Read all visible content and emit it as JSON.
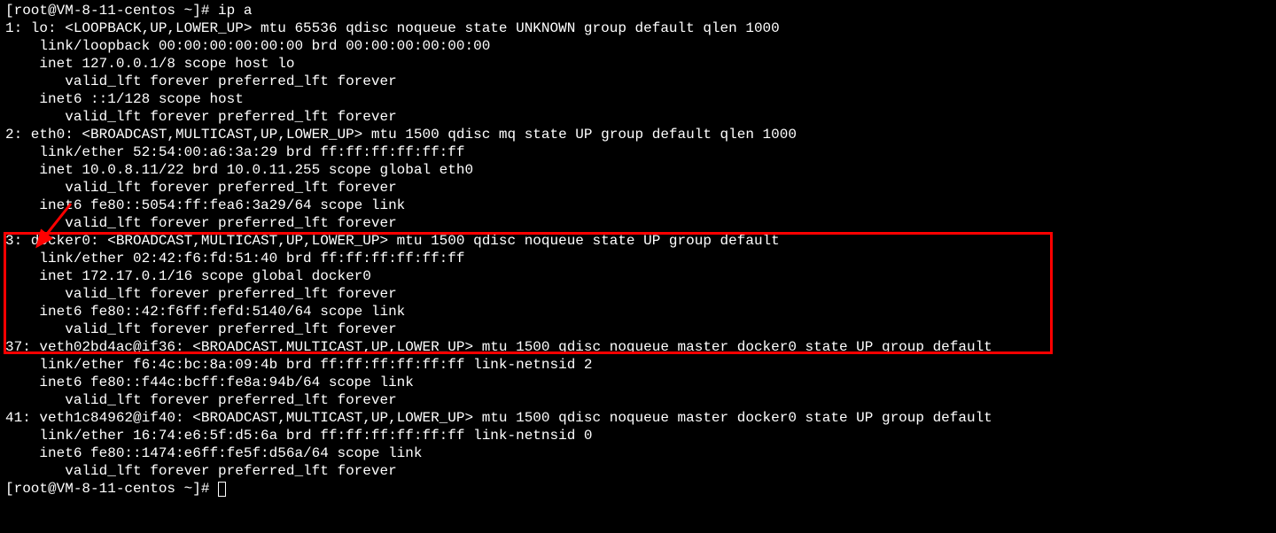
{
  "terminal": {
    "prompt1": "[root@VM-8-11-centos ~]# ip a",
    "l01": "1: lo: <LOOPBACK,UP,LOWER_UP> mtu 65536 qdisc noqueue state UNKNOWN group default qlen 1000",
    "l02": "    link/loopback 00:00:00:00:00:00 brd 00:00:00:00:00:00",
    "l03": "    inet 127.0.0.1/8 scope host lo",
    "l04": "       valid_lft forever preferred_lft forever",
    "l05": "    inet6 ::1/128 scope host ",
    "l06": "       valid_lft forever preferred_lft forever",
    "l07": "2: eth0: <BROADCAST,MULTICAST,UP,LOWER_UP> mtu 1500 qdisc mq state UP group default qlen 1000",
    "l08": "    link/ether 52:54:00:a6:3a:29 brd ff:ff:ff:ff:ff:ff",
    "l09": "    inet 10.0.8.11/22 brd 10.0.11.255 scope global eth0",
    "l10": "       valid_lft forever preferred_lft forever",
    "l11": "    inet6 fe80::5054:ff:fea6:3a29/64 scope link ",
    "l12": "       valid_lft forever preferred_lft forever",
    "l13": "3: docker0: <BROADCAST,MULTICAST,UP,LOWER_UP> mtu 1500 qdisc noqueue state UP group default ",
    "l14": "    link/ether 02:42:f6:fd:51:40 brd ff:ff:ff:ff:ff:ff",
    "l15": "    inet 172.17.0.1/16 scope global docker0",
    "l16": "       valid_lft forever preferred_lft forever",
    "l17": "    inet6 fe80::42:f6ff:fefd:5140/64 scope link ",
    "l18": "       valid_lft forever preferred_lft forever",
    "l19": "37: veth02bd4ac@if36: <BROADCAST,MULTICAST,UP,LOWER_UP> mtu 1500 qdisc noqueue master docker0 state UP group default ",
    "l20": "    link/ether f6:4c:bc:8a:09:4b brd ff:ff:ff:ff:ff:ff link-netnsid 2",
    "l21": "    inet6 fe80::f44c:bcff:fe8a:94b/64 scope link ",
    "l22": "       valid_lft forever preferred_lft forever",
    "l23": "41: veth1c84962@if40: <BROADCAST,MULTICAST,UP,LOWER_UP> mtu 1500 qdisc noqueue master docker0 state UP group default ",
    "l24": "    link/ether 16:74:e6:5f:d5:6a brd ff:ff:ff:ff:ff:ff link-netnsid 0",
    "l25": "    inet6 fe80::1474:e6ff:fe5f:d56a/64 scope link ",
    "l26": "       valid_lft forever preferred_lft forever",
    "prompt2": "[root@VM-8-11-centos ~]# "
  }
}
